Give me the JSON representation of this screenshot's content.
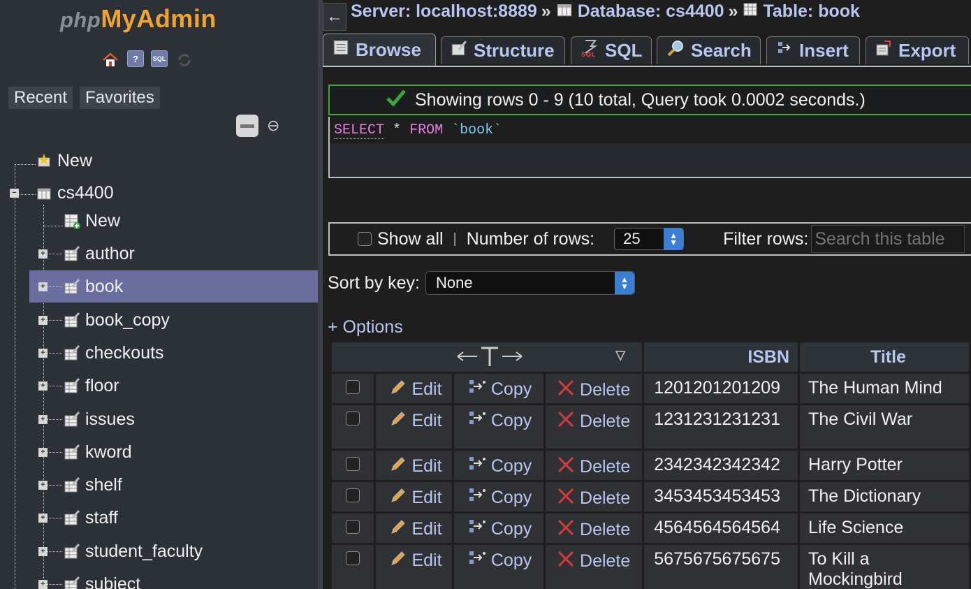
{
  "app": {
    "logo_php": "php",
    "logo_myadmin": "MyAdmin"
  },
  "nav": {
    "icons": [
      "home-icon",
      "help-icon",
      "sql-docs-icon",
      "reload-icon"
    ],
    "tabs": [
      "Recent",
      "Favorites"
    ],
    "tree": {
      "root_new": "New",
      "db": "cs4400",
      "db_new": "New",
      "tables": [
        "author",
        "book",
        "book_copy",
        "checkouts",
        "floor",
        "issues",
        "kword",
        "shelf",
        "staff",
        "student_faculty",
        "subject"
      ],
      "selected": "book"
    }
  },
  "breadcrumb": {
    "server": "Server: localhost:8889",
    "sep": "»",
    "database": "Database: cs4400",
    "table": "Table: book"
  },
  "tabs": [
    "Browse",
    "Structure",
    "SQL",
    "Search",
    "Insert",
    "Export"
  ],
  "success": {
    "message": "Showing rows 0 - 9 (10 total, Query took 0.0002 seconds.)"
  },
  "sql": {
    "kw1": "SELECT",
    "star": "*",
    "kw2": "FROM",
    "table": "`book`"
  },
  "controls": {
    "show_all": "Show all",
    "pipe": "|",
    "rows_label": "Number of rows:",
    "rows_value": "25",
    "filter_label": "Filter rows:",
    "filter_placeholder": "Search this table",
    "sort_label": "Sort by key:",
    "sort_value": "None",
    "options": "+ Options"
  },
  "table": {
    "columns": [
      "ISBN",
      "Title"
    ],
    "actions": {
      "edit": "Edit",
      "copy": "Copy",
      "delete": "Delete"
    },
    "rows": [
      {
        "isbn": "1201201201209",
        "title": "The Human Mind"
      },
      {
        "isbn": "1231231231231",
        "title": "The Civil War"
      },
      {
        "isbn": "2342342342342",
        "title": "Harry Potter"
      },
      {
        "isbn": "3453453453453",
        "title": "The Dictionary"
      },
      {
        "isbn": "4564564564564",
        "title": "Life Science"
      },
      {
        "isbn": "5675675675675",
        "title": "To Kill a Mockingbird"
      }
    ]
  },
  "colors": {
    "accent": "#b9c6f2",
    "selected": "#6a6d9e",
    "success_border": "#4a9f4a",
    "logo": "#f0a330"
  }
}
